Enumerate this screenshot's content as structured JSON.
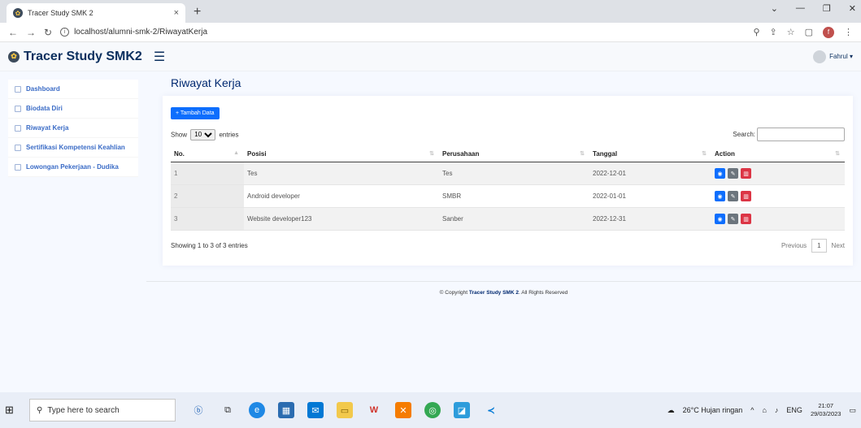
{
  "browser": {
    "tab_title": "Tracer Study SMK 2",
    "tab_close": "×",
    "new_tab": "+",
    "url": "localhost/alumni-smk-2/RiwayatKerja",
    "profile_initial": "f"
  },
  "app": {
    "brand": "Tracer Study SMK2",
    "user": "Fahrul ▾"
  },
  "sidebar": {
    "items": [
      {
        "label": "Dashboard"
      },
      {
        "label": "Biodata Diri"
      },
      {
        "label": "Riwayat Kerja"
      },
      {
        "label": "Sertifikasi Kompetensi Keahlian"
      },
      {
        "label": "Lowongan Pekerjaan - Dudika"
      }
    ]
  },
  "page": {
    "title": "Riwayat Kerja",
    "add_button": "+ Tambah Data",
    "show_label": "Show",
    "entries_label": "entries",
    "page_length": "10",
    "search_label": "Search:",
    "columns": [
      "No.",
      "Posisi",
      "Perusahaan",
      "Tanggal",
      "Action"
    ],
    "rows": [
      {
        "no": "1",
        "posisi": "Tes",
        "perusahaan": "Tes",
        "tanggal": "2022-12-01"
      },
      {
        "no": "2",
        "posisi": "Android developer",
        "perusahaan": "SMBR",
        "tanggal": "2022-01-01"
      },
      {
        "no": "3",
        "posisi": "Website developer123",
        "perusahaan": "Sanber",
        "tanggal": "2022-12-31"
      }
    ],
    "info": "Showing 1 to 3 of 3 entries",
    "previous": "Previous",
    "page_num": "1",
    "next": "Next"
  },
  "footer": {
    "prefix": "© Copyright ",
    "brand": "Tracer Study SMK 2",
    "suffix": ". All Rights Reserved"
  },
  "taskbar": {
    "search_placeholder": "Type here to search",
    "weather": "26°C  Hujan ringan",
    "lang": "ENG",
    "time": "21:07",
    "date": "29/03/2023"
  }
}
